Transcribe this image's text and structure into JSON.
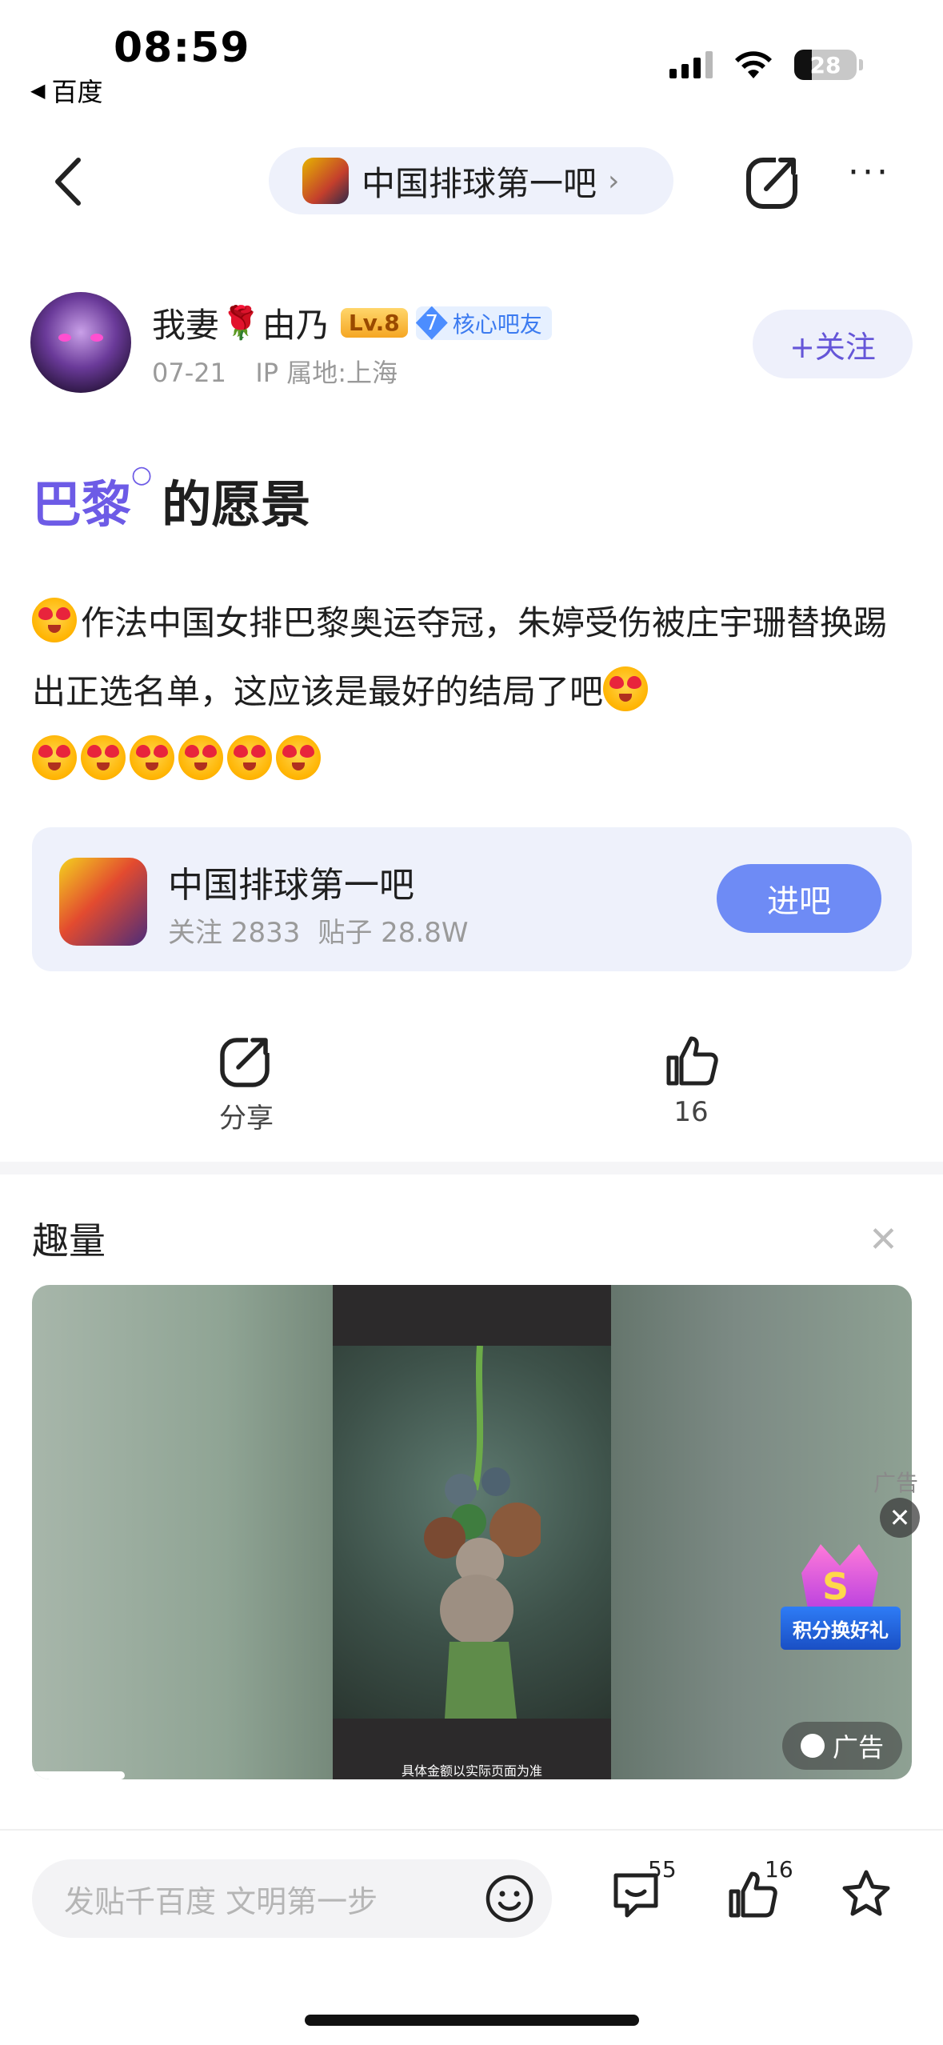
{
  "status_bar": {
    "time": "08:59",
    "back_app": "百度",
    "battery": "28",
    "battery_level": 0.28
  },
  "nav": {
    "forum_name": "中国排球第一吧",
    "back_icon": "chevron-left-icon",
    "share_icon": "share-icon",
    "more_icon": "more-icon"
  },
  "author": {
    "name_part1": "我妻",
    "name_part2": "由乃",
    "level": "Lv.8",
    "badge_number": "7",
    "badge_text": "核心吧友",
    "date": "07-21",
    "ip": "IP 属地:上海",
    "follow_label": "+关注"
  },
  "post": {
    "title_link": "巴黎",
    "title_rest": "的愿景",
    "body_text": "作法中国女排巴黎奥运夺冠，朱婷受伤被庄宇珊替换踢出正选名单，这应该是最好的结局了吧"
  },
  "forum_card": {
    "name": "中国排球第一吧",
    "followers_label": "关注 2833",
    "posts_label": "贴子 28.8W",
    "enter_label": "进吧"
  },
  "actions": {
    "share_label": "分享",
    "like_count": "16"
  },
  "ad": {
    "header": "趣量",
    "caption": "具体金额以实际页面为准",
    "label_top": "广告",
    "gift_text": "积分换好礼",
    "gift_letter": "S",
    "tag_label": "广告"
  },
  "bottom_bar": {
    "compose_placeholder": "发贴千百度 文明第一步",
    "comment_count": "55",
    "like_count": "16"
  },
  "colors": {
    "accent": "#6d5be6",
    "enter_button": "#6e8bf5",
    "card_bg": "#eef1fb"
  }
}
